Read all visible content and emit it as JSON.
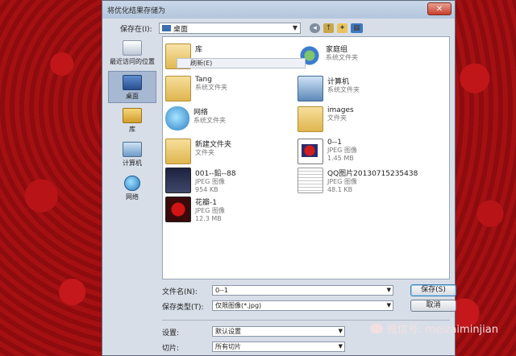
{
  "dialog": {
    "title": "将优化结果存储为",
    "close_glyph": "✕",
    "save_in_label": "保存在(I):",
    "save_in_value": "桌面"
  },
  "places": [
    {
      "label": "最近访问的位置",
      "icon": "recent-icon"
    },
    {
      "label": "桌面",
      "icon": "desktop-icon",
      "active": true
    },
    {
      "label": "库",
      "icon": "library-icon"
    },
    {
      "label": "计算机",
      "icon": "computer-icon"
    },
    {
      "label": "网络",
      "icon": "network-icon"
    }
  ],
  "files": [
    {
      "name": "库",
      "meta1": "",
      "meta2": "",
      "icon": "library-folder-icon"
    },
    {
      "name": "家庭组",
      "meta1": "系统文件夹",
      "meta2": "",
      "icon": "homegroup-icon"
    },
    {
      "name": "Tang",
      "meta1": "系统文件夹",
      "meta2": "",
      "icon": "folder-icon"
    },
    {
      "name": "计算机",
      "meta1": "系统文件夹",
      "meta2": "",
      "icon": "computer-icon"
    },
    {
      "name": "网络",
      "meta1": "系统文件夹",
      "meta2": "",
      "icon": "network-icon"
    },
    {
      "name": "images",
      "meta1": "文件夹",
      "meta2": "",
      "icon": "folder-icon"
    },
    {
      "name": "新建文件夹",
      "meta1": "文件夹",
      "meta2": "",
      "icon": "folder-icon"
    },
    {
      "name": "0--1",
      "meta1": "JPEG 图像",
      "meta2": "1.45 MB",
      "icon": "jpeg-icon"
    },
    {
      "name": "001--鉛--88",
      "meta1": "JPEG 图像",
      "meta2": "954 KB",
      "icon": "jpeg-icon"
    },
    {
      "name": "QQ图片20130715235438",
      "meta1": "JPEG 图像",
      "meta2": "48.1 KB",
      "icon": "jpeg-icon"
    },
    {
      "name": "花瓣-1",
      "meta1": "JPEG 图像",
      "meta2": "12.3 MB",
      "icon": "jpeg-icon"
    }
  ],
  "context_menu": {
    "refresh": "刷新(E)"
  },
  "form": {
    "filename_label": "文件名(N):",
    "filename_value": "0--1",
    "filetype_label": "保存类型(T):",
    "filetype_value": "仅限图像(*.jpg)",
    "save_button": "保存(S)",
    "cancel_button": "取消",
    "settings_label": "设置:",
    "settings_value": "默认设置",
    "slices_label": "切片:",
    "slices_value": "所有切片"
  },
  "watermark": "微信号: meizaiminjian"
}
